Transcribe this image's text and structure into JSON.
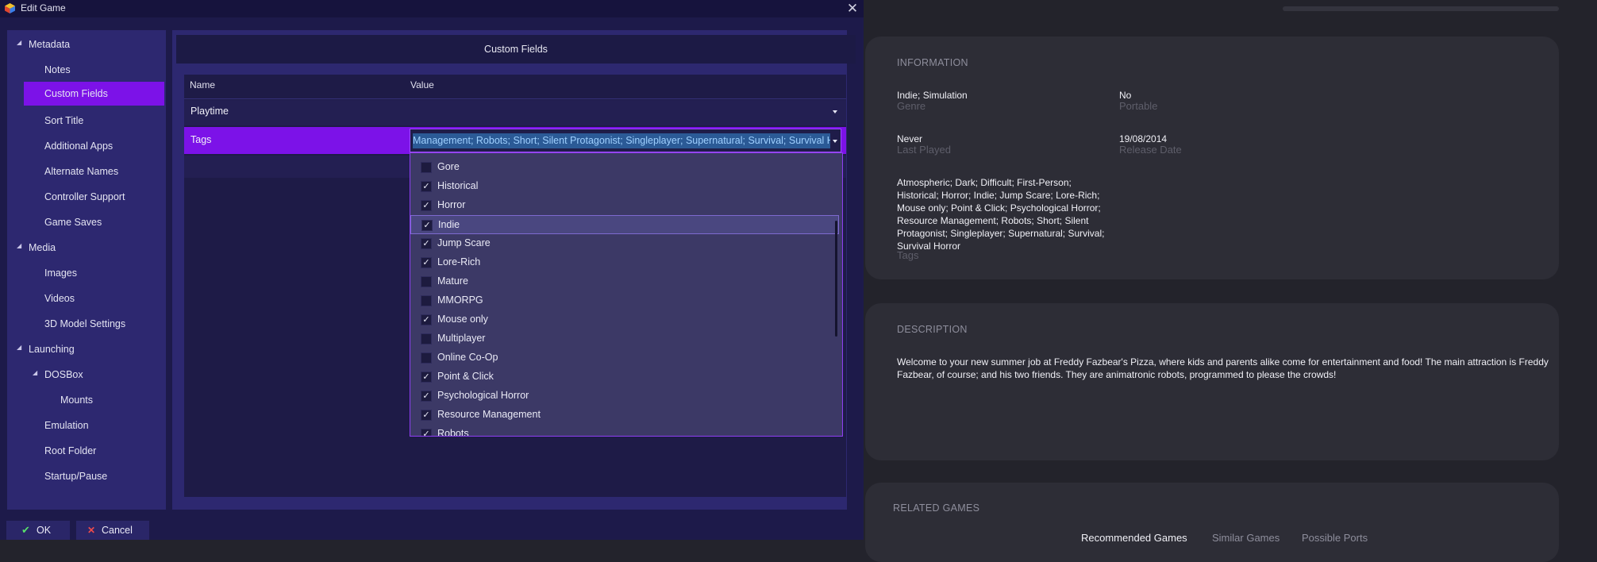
{
  "window": {
    "title": "Edit Game"
  },
  "sidebar": {
    "items": [
      {
        "label": "Metadata"
      },
      {
        "label": "Notes"
      },
      {
        "label": "Custom Fields"
      },
      {
        "label": "Sort Title"
      },
      {
        "label": "Additional Apps"
      },
      {
        "label": "Alternate Names"
      },
      {
        "label": "Controller Support"
      },
      {
        "label": "Game Saves"
      },
      {
        "label": "Media"
      },
      {
        "label": "Images"
      },
      {
        "label": "Videos"
      },
      {
        "label": "3D Model Settings"
      },
      {
        "label": "Launching"
      },
      {
        "label": "DOSBox"
      },
      {
        "label": "Mounts"
      },
      {
        "label": "Emulation"
      },
      {
        "label": "Root Folder"
      },
      {
        "label": "Startup/Pause"
      }
    ]
  },
  "custom_fields": {
    "header": "Custom Fields",
    "col_name": "Name",
    "col_value": "Value",
    "rows": [
      {
        "name": "Playtime",
        "value": ""
      },
      {
        "name": "Tags",
        "value": "Management; Robots; Short; Silent Protagonist; Singleplayer; Supernatural; Survival; Survival Horror"
      }
    ]
  },
  "tag_options": [
    {
      "label": "Gore",
      "checked": false
    },
    {
      "label": "Historical",
      "checked": true
    },
    {
      "label": "Horror",
      "checked": true
    },
    {
      "label": "Indie",
      "checked": true
    },
    {
      "label": "Jump Scare",
      "checked": true
    },
    {
      "label": "Lore-Rich",
      "checked": true
    },
    {
      "label": "Mature",
      "checked": false
    },
    {
      "label": "MMORPG",
      "checked": false
    },
    {
      "label": "Mouse only",
      "checked": true
    },
    {
      "label": "Multiplayer",
      "checked": false
    },
    {
      "label": "Online Co-Op",
      "checked": false
    },
    {
      "label": "Point & Click",
      "checked": true
    },
    {
      "label": "Psychological Horror",
      "checked": true
    },
    {
      "label": "Resource Management",
      "checked": true
    },
    {
      "label": "Robots",
      "checked": true
    }
  ],
  "buttons": {
    "ok": "OK",
    "cancel": "Cancel"
  },
  "info": {
    "section": "INFORMATION",
    "genre_value": "Indie; Simulation",
    "genre_label": "Genre",
    "portable_value": "No",
    "portable_label": "Portable",
    "last_played_value": "Never",
    "last_played_label": "Last Played",
    "release_value": "19/08/2014",
    "release_label": "Release Date",
    "tags_value": "Atmospheric; Dark; Difficult; First-Person; Historical; Horror; Indie; Jump Scare; Lore-Rich; Mouse only; Point & Click; Psychological Horror; Resource Management; Robots; Short; Silent Protagonist; Singleplayer; Supernatural; Survival; Survival Horror",
    "tags_label": "Tags"
  },
  "description": {
    "section": "DESCRIPTION",
    "text": "Welcome to your new summer job at Freddy Fazbear's Pizza, where kids and parents alike come for entertainment and food! The main attraction is Freddy Fazbear, of course; and his two friends. They are animatronic robots, programmed to please the crowds!"
  },
  "related": {
    "section": "RELATED GAMES",
    "tabs": [
      "Recommended Games",
      "Similar Games",
      "Possible Ports"
    ]
  },
  "colors": {
    "accent": "#7c12e8",
    "dialog_bg": "#1d1a4a",
    "panel_bg": "#2d2870",
    "card_bg": "#2d2d36"
  }
}
